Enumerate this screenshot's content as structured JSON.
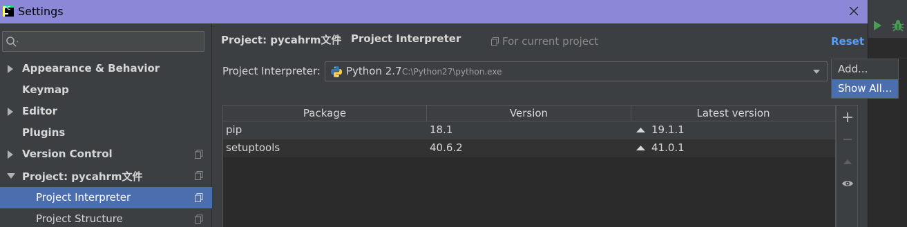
{
  "window": {
    "title": "Settings"
  },
  "search": {
    "placeholder": ""
  },
  "sidebar": {
    "items": [
      {
        "label": "Appearance & Behavior"
      },
      {
        "label": "Keymap"
      },
      {
        "label": "Editor"
      },
      {
        "label": "Plugins"
      },
      {
        "label": "Version Control"
      },
      {
        "label": "Project: pycahrm文件"
      },
      {
        "label": "Project Interpreter"
      },
      {
        "label": "Project Structure"
      }
    ]
  },
  "breadcrumb": {
    "parent": "Project: pycahrm文件",
    "separator": "›",
    "current": "Project Interpreter"
  },
  "scope_label": "For current project",
  "reset_label": "Reset",
  "interpreter": {
    "label": "Project Interpreter:",
    "name": "Python 2.7",
    "path": "C:\\Python27\\python.exe"
  },
  "popup": {
    "items": [
      "Add...",
      "Show All..."
    ]
  },
  "table": {
    "columns": [
      "Package",
      "Version",
      "Latest version"
    ],
    "rows": [
      {
        "package": "pip",
        "version": "18.1",
        "latest": "19.1.1"
      },
      {
        "package": "setuptools",
        "version": "40.6.2",
        "latest": "41.0.1"
      }
    ]
  },
  "colors": {
    "accent": "#4b6eaf",
    "link": "#589df6",
    "titlebar": "#8c88d8",
    "run": "#499c54"
  },
  "icons": [
    "app-icon",
    "close-icon",
    "run-icon",
    "debug-icon",
    "search-icon",
    "expand-arrow-icon",
    "copy-icon",
    "python-icon",
    "chevron-down-icon",
    "upgrade-arrow-icon",
    "add-icon",
    "remove-icon",
    "upgrade-icon",
    "eye-icon"
  ]
}
